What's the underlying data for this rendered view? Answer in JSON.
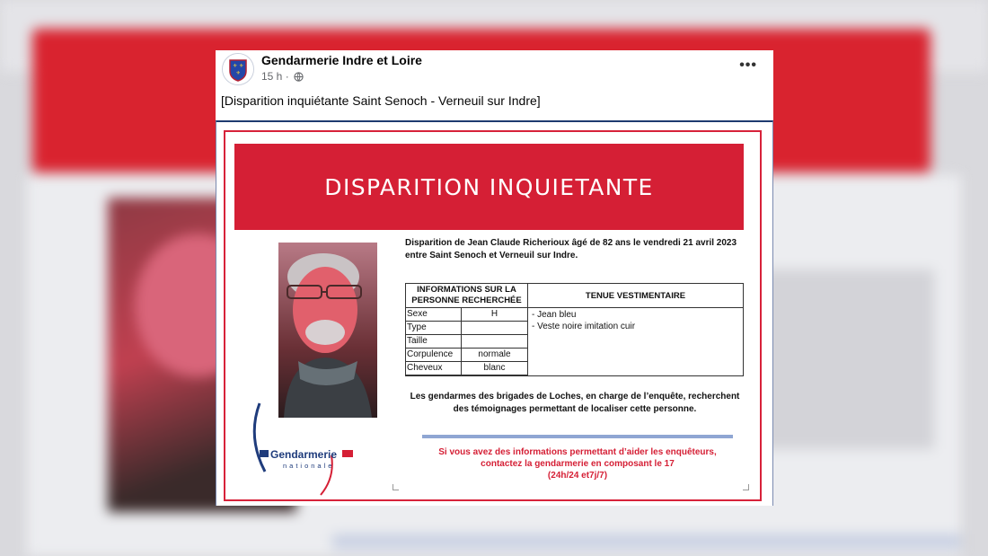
{
  "post": {
    "page_name": "Gendarmerie Indre et Loire",
    "time": "15 h",
    "text": "[Disparition inquiétante Saint Senoch - Verneuil sur Indre]",
    "more_icon": "more-options-icon",
    "privacy_icon": "globe-icon"
  },
  "poster": {
    "title": "DISPARITION INQUIETANTE",
    "intro": "Disparition de Jean Claude Richerioux âgé de 82 ans le vendredi 21 avril 2023 entre Saint Senoch et Verneuil sur Indre.",
    "table": {
      "header_left": "INFORMATIONS SUR LA PERSONNE RECHERCHÉE",
      "header_right": "TENUE VESTIMENTAIRE",
      "rows": [
        {
          "label": "Sexe",
          "value": "H"
        },
        {
          "label": "Type",
          "value": ""
        },
        {
          "label": "Taille",
          "value": ""
        },
        {
          "label": "Corpulence",
          "value": "normale"
        },
        {
          "label": "Cheveux",
          "value": "blanc"
        }
      ],
      "clothing": [
        "- Jean bleu",
        "- Veste noire imitation cuir"
      ]
    },
    "search_text": "Les gendarmes des brigades de Loches, en charge de l’enquête, recherchent des témoignages permettant de localiser cette personne.",
    "contact_lines": [
      "Si vous avez des informations permettant d’aider les enquêteurs,",
      "contactez la gendarmerie en composant le 17",
      "(24h/24 et7j/7)"
    ],
    "logo_name": "Gendarmerie",
    "logo_sub": "nationale"
  },
  "colors": {
    "banner_red": "#d51f35",
    "logo_blue": "#1f3c7c"
  }
}
